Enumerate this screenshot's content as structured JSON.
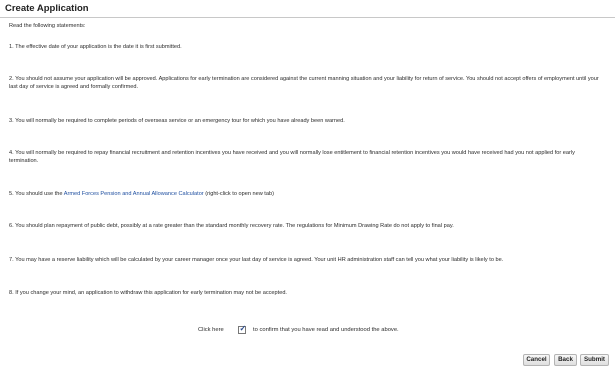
{
  "page": {
    "title": "Create Application"
  },
  "intro": "Read the following statements:",
  "statements": [
    {
      "text": "1. The effective date of your application is the date it is first submitted."
    },
    {
      "text": "2. You should not assume your application will be approved. Applications for early termination are considered against the current manning situation and your liability for return of service. You should not accept offers of employment until your last day of service is agreed and formally confirmed."
    },
    {
      "text": "3. You will normally be required to complete periods of overseas service or an emergency tour for which you have already been warned."
    },
    {
      "text": "4. You will normally be required to repay financial recruitment and retention incentives you have received and you will normally lose entitlement to financial retention incentives you would have received had you not applied for early termination."
    },
    {
      "before": "5. You should use the ",
      "link": "Armed Forces Pension and Annual Allowance Calculator",
      "after": " (right-click to open new tab)"
    },
    {
      "text": "6. You should plan repayment of public debt, possibly at a rate greater than the standard monthly recovery rate. The regulations for Minimum Drawing Rate do not apply to final pay."
    },
    {
      "text": "7. You may have a reserve liability which will be calculated by your career manager once your last day of service is agreed. Your unit HR administration staff can tell you what your liability is likely to be."
    },
    {
      "text": "8. If you change your mind, an application to withdraw this application for early termination may not be accepted."
    }
  ],
  "confirm": {
    "before": "Click here",
    "after": "to confirm that you have read and understood the above.",
    "checked": true,
    "check_glyph": "✓"
  },
  "buttons": {
    "cancel": "Cancel",
    "back": "Back",
    "submit": "Submit"
  },
  "icons": {
    "confirm_checkbox": "checkmark-icon"
  },
  "colors": {
    "link": "#1f4fa0",
    "check": "#2a4b8d"
  }
}
